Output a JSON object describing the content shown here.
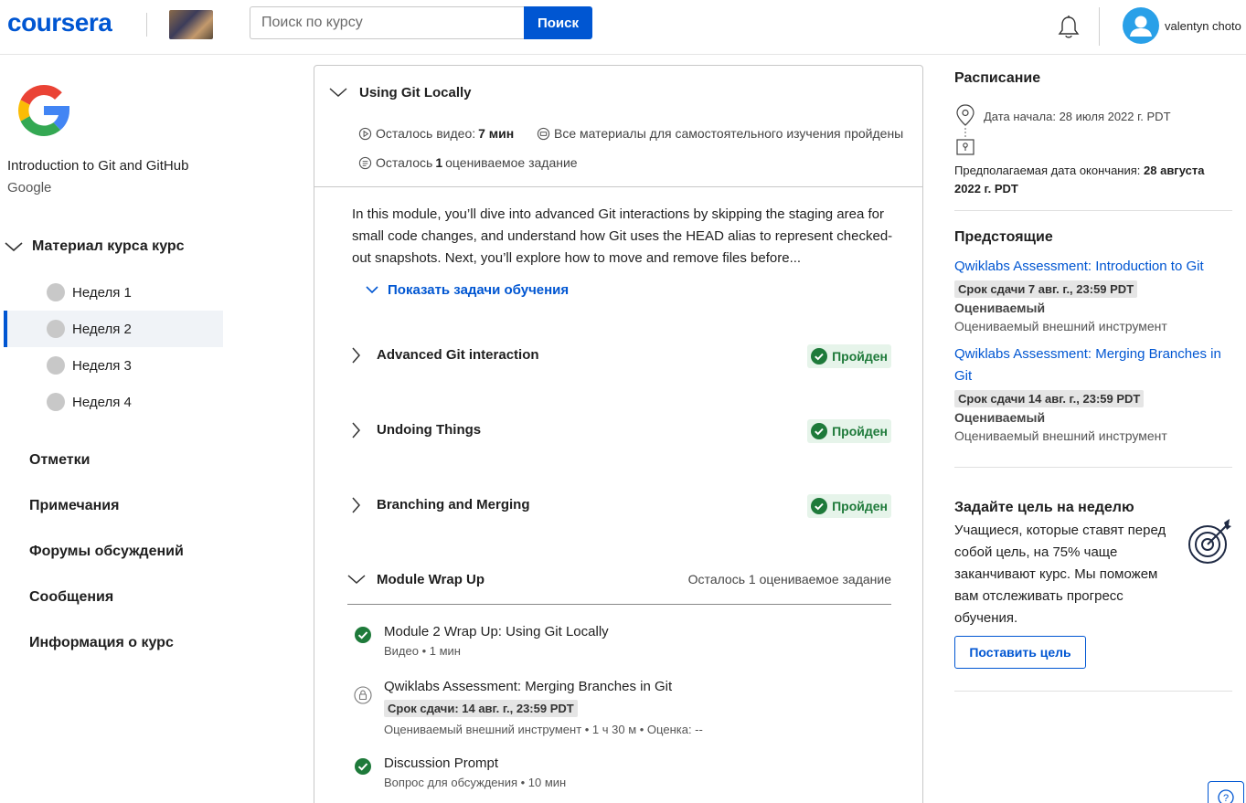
{
  "header": {
    "logo": "coursera",
    "search_placeholder": "Поиск по курсу",
    "search_button": "Поиск",
    "username": "valentyn choto"
  },
  "sidebar": {
    "course_title": "Introduction to Git and GitHub",
    "course_org": "Google",
    "material_label": "Материал курса курс",
    "weeks": [
      "Неделя 1",
      "Неделя 2",
      "Неделя 3",
      "Неделя 4"
    ],
    "active_week": 1,
    "links": [
      "Отметки",
      "Примечания",
      "Форумы обсуждений",
      "Сообщения",
      "Информация о курс"
    ]
  },
  "module": {
    "title": "Using Git Locally",
    "video_left_label": "Осталось видео:",
    "video_left_value": "7 мин",
    "self_study": "Все материалы для самостоятельного изучения пройдены",
    "graded_left_prefix": "Осталось",
    "graded_left_count": "1",
    "graded_left_suffix": "оцениваемое задание",
    "description": "In this module, you’ll dive into advanced Git interactions by skipping the staging area for small code changes, and understand how Git uses the HEAD alias to represent checked-out snapshots. Next, you’ll explore how to move and remove files before...",
    "show_goals": "Показать задачи обучения",
    "lessons": [
      {
        "title": "Advanced Git interaction",
        "status": "Пройден"
      },
      {
        "title": "Undoing Things",
        "status": "Пройден"
      },
      {
        "title": "Branching and Merging",
        "status": "Пройден"
      }
    ],
    "wrap_up": {
      "title": "Module Wrap Up",
      "remaining": "Осталось 1 оцениваемое задание",
      "items": [
        {
          "title": "Module 2 Wrap Up: Using Git Locally",
          "sub": "Видео • 1 мин"
        },
        {
          "title": "Qwiklabs Assessment: Merging Branches in Git",
          "due": "Срок сдачи: 14 авг. г., 23:59 PDT",
          "sub": "Оцениваемый внешний инструмент • 1 ч 30 м • Оценка: --"
        },
        {
          "title": "Discussion Prompt",
          "sub": "Вопрос для обсуждения • 10 мин"
        }
      ]
    }
  },
  "schedule": {
    "title": "Расписание",
    "start": "Дата начала: 28 июля 2022 г. PDT",
    "end_label": "Предполагаемая дата окончания:",
    "end_value_1": "28 августа",
    "end_value_2": "2022 г. PDT"
  },
  "upcoming": {
    "title": "Предстоящие",
    "items": [
      {
        "title": "Qwiklabs Assessment: Introduction to Git",
        "title_2": "",
        "due": "Срок сдачи 7 авг. г., 23:59 PDT",
        "graded": "Оцениваемый",
        "type": "Оцениваемый внешний инструмент"
      },
      {
        "title": "Qwiklabs Assessment: Merging Branches in",
        "title_2": "Git",
        "due": "Срок сдачи 14 авг. г., 23:59 PDT",
        "graded": "Оцениваемый",
        "type": "Оцениваемый внешний инструмент"
      }
    ]
  },
  "goal": {
    "title": "Задайте цель на неделю",
    "text": "Учащиеся, которые ставят перед собой цель, на 75% чаще заканчивают курс. Мы поможем вам отслеживать прогресс обучения.",
    "button": "Поставить цель"
  },
  "colors": {
    "brand": "#0056d2",
    "pass_bg": "#e6f4ea",
    "pass_text": "#1e7a3a"
  },
  "icons": {
    "notifications": "bell-icon",
    "avatar": "user-avatar-icon",
    "help": "help-icon"
  }
}
